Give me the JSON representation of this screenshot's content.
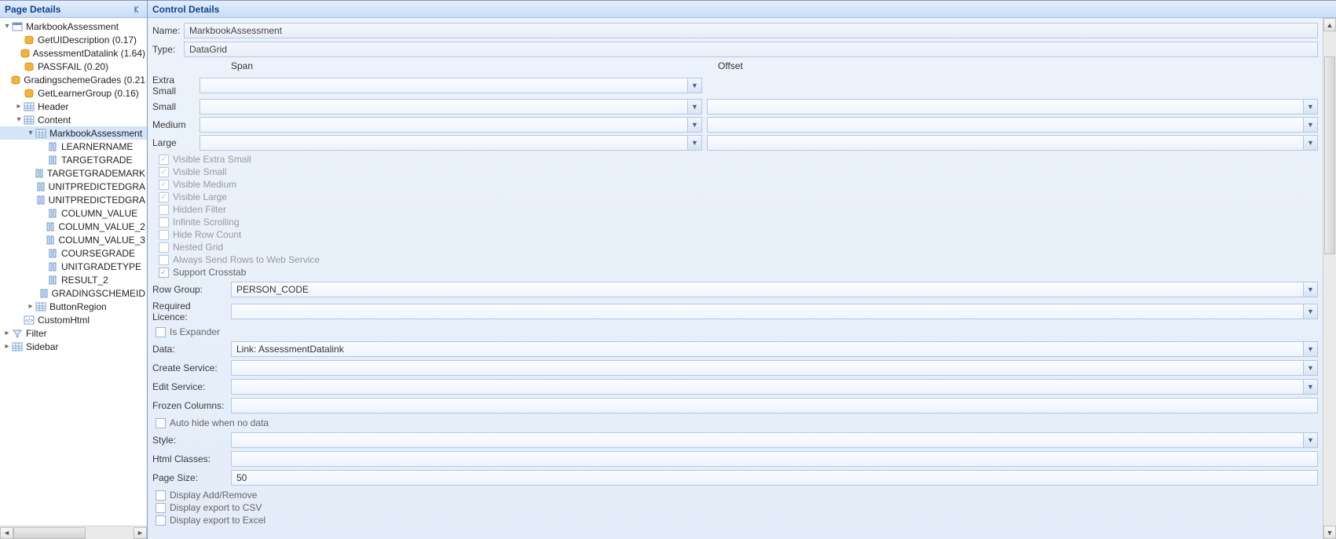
{
  "leftPanel": {
    "title": "Page Details",
    "scroll": {
      "leftArrow": "◄",
      "rightArrow": "►"
    },
    "tree": [
      {
        "depth": 0,
        "toggle": "▾",
        "icon": "form",
        "label": "MarkbookAssessment"
      },
      {
        "depth": 1,
        "toggle": "",
        "icon": "db",
        "label": "GetUIDescription (0.17)"
      },
      {
        "depth": 1,
        "toggle": "",
        "icon": "db",
        "label": "AssessmentDatalink (1.64)"
      },
      {
        "depth": 1,
        "toggle": "",
        "icon": "db",
        "label": "PASSFAIL (0.20)"
      },
      {
        "depth": 1,
        "toggle": "",
        "icon": "db",
        "label": "GradingschemeGrades (0.21"
      },
      {
        "depth": 1,
        "toggle": "",
        "icon": "db",
        "label": "GetLearnerGroup (0.16)"
      },
      {
        "depth": 1,
        "toggle": "▸",
        "icon": "grid",
        "label": "Header"
      },
      {
        "depth": 1,
        "toggle": "▾",
        "icon": "grid",
        "label": "Content"
      },
      {
        "depth": 2,
        "toggle": "▾",
        "icon": "grid",
        "label": "MarkbookAssessment",
        "selected": true
      },
      {
        "depth": 3,
        "toggle": "",
        "icon": "col",
        "label": "LEARNERNAME"
      },
      {
        "depth": 3,
        "toggle": "",
        "icon": "col",
        "label": "TARGETGRADE"
      },
      {
        "depth": 3,
        "toggle": "",
        "icon": "col",
        "label": "TARGETGRADEMARK"
      },
      {
        "depth": 3,
        "toggle": "",
        "icon": "col",
        "label": "UNITPREDICTEDGRA"
      },
      {
        "depth": 3,
        "toggle": "",
        "icon": "col",
        "label": "UNITPREDICTEDGRA"
      },
      {
        "depth": 3,
        "toggle": "",
        "icon": "col",
        "label": "COLUMN_VALUE"
      },
      {
        "depth": 3,
        "toggle": "",
        "icon": "col",
        "label": "COLUMN_VALUE_2"
      },
      {
        "depth": 3,
        "toggle": "",
        "icon": "col",
        "label": "COLUMN_VALUE_3"
      },
      {
        "depth": 3,
        "toggle": "",
        "icon": "col",
        "label": "COURSEGRADE"
      },
      {
        "depth": 3,
        "toggle": "",
        "icon": "col",
        "label": "UNITGRADETYPE"
      },
      {
        "depth": 3,
        "toggle": "",
        "icon": "col",
        "label": "RESULT_2"
      },
      {
        "depth": 3,
        "toggle": "",
        "icon": "col",
        "label": "GRADINGSCHEMEID"
      },
      {
        "depth": 2,
        "toggle": "▸",
        "icon": "grid",
        "label": "ButtonRegion"
      },
      {
        "depth": 1,
        "toggle": "",
        "icon": "html",
        "label": "CustomHtml"
      },
      {
        "depth": 0,
        "toggle": "▸",
        "icon": "filter",
        "label": "Filter"
      },
      {
        "depth": 0,
        "toggle": "▸",
        "icon": "grid",
        "label": "Sidebar"
      }
    ]
  },
  "rightPanel": {
    "title": "Control Details",
    "nameLabel": "Name:",
    "nameValue": "MarkbookAssessment",
    "typeLabel": "Type:",
    "typeValue": "DataGrid",
    "spanOffset": {
      "spanHeader": "Span",
      "offsetHeader": "Offset",
      "rows": [
        {
          "label": "Extra Small",
          "span": "",
          "offset": ""
        },
        {
          "label": "Small",
          "span": "",
          "offset": ""
        },
        {
          "label": "Medium",
          "span": "",
          "offset": ""
        },
        {
          "label": "Large",
          "span": "",
          "offset": ""
        }
      ]
    },
    "checks": [
      {
        "label": "Visible Extra Small",
        "checked": true,
        "dim": true
      },
      {
        "label": "Visible Small",
        "checked": true,
        "dim": true
      },
      {
        "label": "Visible Medium",
        "checked": true,
        "dim": true
      },
      {
        "label": "Visible Large",
        "checked": true,
        "dim": true
      },
      {
        "label": "Hidden Filter",
        "checked": false,
        "dim": true
      },
      {
        "label": "Infinite Scrolling",
        "checked": false,
        "dim": true
      },
      {
        "label": "Hide Row Count",
        "checked": false,
        "dim": true
      },
      {
        "label": "Nested Grid",
        "checked": false,
        "dim": true
      },
      {
        "label": "Always Send Rows to Web Service",
        "checked": false,
        "dim": true
      },
      {
        "label": "Support Crosstab",
        "checked": true,
        "dim": false
      }
    ],
    "rowGroupLabel": "Row Group:",
    "rowGroupValue": "PERSON_CODE",
    "reqLicenceLabel": "Required Licence:",
    "reqLicenceValue": "",
    "isExpanderLabel": "Is Expander",
    "dataLabel": "Data:",
    "dataValue": "Link: AssessmentDatalink",
    "createServiceLabel": "Create Service:",
    "createServiceValue": "",
    "editServiceLabel": "Edit Service:",
    "editServiceValue": "",
    "frozenColsLabel": "Frozen Columns:",
    "frozenColsValue": "",
    "autoHideLabel": "Auto hide when no data",
    "styleLabel": "Style:",
    "styleValue": "",
    "htmlClassesLabel": "Html Classes:",
    "htmlClassesValue": "",
    "pageSizeLabel": "Page Size:",
    "pageSizeValue": "50",
    "displayAddRemoveLabel": "Display Add/Remove",
    "displayCsvLabel": "Display export to CSV",
    "displayExcelLabel": "Display export to Excel"
  }
}
